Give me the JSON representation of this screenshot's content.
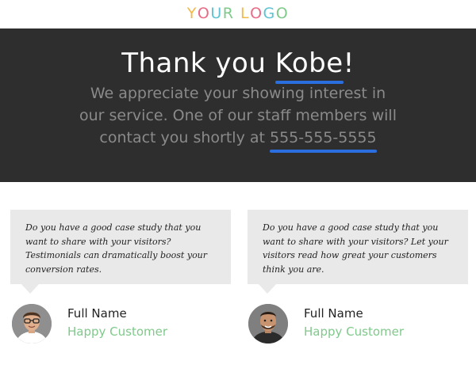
{
  "logo": {
    "letters": [
      {
        "char": "Y",
        "color": "#f2b94b"
      },
      {
        "char": "O",
        "color": "#e86b87"
      },
      {
        "char": "U",
        "color": "#5ec3d3"
      },
      {
        "char": "R",
        "color": "#7fc98b"
      },
      {
        "char": " ",
        "color": "#ffffff"
      },
      {
        "char": "L",
        "color": "#f2b94b"
      },
      {
        "char": "O",
        "color": "#e86b87"
      },
      {
        "char": "G",
        "color": "#5ec3d3"
      },
      {
        "char": "O",
        "color": "#7fc98b"
      }
    ]
  },
  "hero": {
    "title_prefix": "Thank you ",
    "name": "Kobe",
    "title_suffix": "!",
    "body": "We appreciate your showing interest in our service. One of our staff members will contact you shortly at ",
    "phone": "555-555-5555"
  },
  "testimonials": [
    {
      "quote": "Do you have a good case study that you want to share with your visitors? Testimonials can dramatically boost your conversion rates.",
      "name": "Full Name",
      "role": "Happy Customer"
    },
    {
      "quote": "Do you have a good case study that you want to share with your visitors? Let your visitors read how great your customers think you are.",
      "name": "Full Name",
      "role": "Happy Customer"
    }
  ],
  "colors": {
    "hero_bg": "#2e2e2e",
    "accent_underline": "#2a6ee0",
    "role_green": "#7fc98b",
    "card_bg": "#e9e9e9"
  }
}
